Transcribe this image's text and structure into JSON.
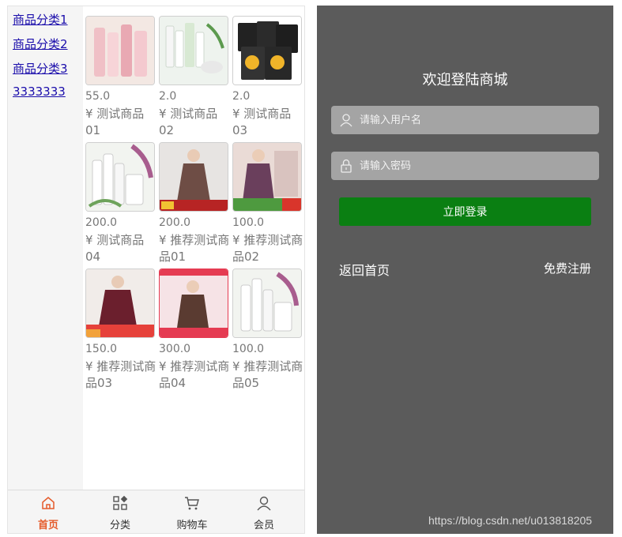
{
  "categories": [
    "商品分类1",
    "商品分类2",
    "商品分类3",
    "3333333"
  ],
  "products": [
    {
      "price": "55.0",
      "name": "¥ 测试商品01",
      "image": "cosmetic-tubes"
    },
    {
      "price": "2.0",
      "name": "¥ 测试商品02",
      "image": "skincare-set"
    },
    {
      "price": "2.0",
      "name": "¥ 测试商品03",
      "image": "face-masks"
    },
    {
      "price": "200.0",
      "name": "¥ 测试商品04",
      "image": "white-skincare-bottles"
    },
    {
      "price": "200.0",
      "name": "¥ 推荐测试商品01",
      "image": "brown-coat-model"
    },
    {
      "price": "100.0",
      "name": "¥ 推荐测试商品02",
      "image": "purple-coat-model"
    },
    {
      "price": "150.0",
      "name": "¥ 推荐测试商品03",
      "image": "burgundy-coat-model"
    },
    {
      "price": "300.0",
      "name": "¥ 推荐测试商品04",
      "image": "brown-coat-model-2"
    },
    {
      "price": "100.0",
      "name": "¥ 推荐测试商品05",
      "image": "white-skincare-bottles-2"
    }
  ],
  "tabbar": [
    {
      "label": "首页",
      "icon": "home-icon",
      "active": true
    },
    {
      "label": "分类",
      "icon": "category-icon",
      "active": false
    },
    {
      "label": "购物车",
      "icon": "cart-icon",
      "active": false
    },
    {
      "label": "会员",
      "icon": "user-icon",
      "active": false
    }
  ],
  "login": {
    "title": "欢迎登陆商城",
    "username_placeholder": "请输入用户名",
    "password_placeholder": "请输入密码",
    "submit_label": "立即登录",
    "home_link": "返回首页",
    "register_link": "免费注册"
  },
  "watermark": "https://blog.csdn.net/u013818205",
  "colors": {
    "accent": "#e55b2b",
    "login_button": "#0a7f12",
    "panel_bg": "#5b5b5b"
  }
}
